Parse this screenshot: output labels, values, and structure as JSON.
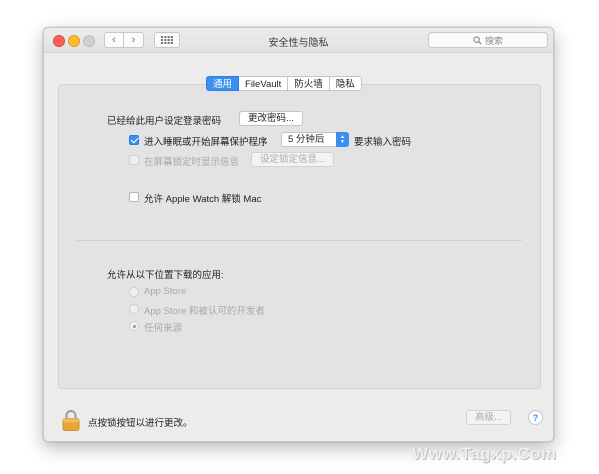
{
  "window": {
    "title": "安全性与隐私",
    "search_placeholder": "搜索",
    "nav_back": "‹",
    "nav_forward": "›"
  },
  "tabs": [
    {
      "label": "通用",
      "active": true
    },
    {
      "label": "FileVault",
      "active": false
    },
    {
      "label": "防火墙",
      "active": false
    },
    {
      "label": "隐私",
      "active": false
    }
  ],
  "general": {
    "password_set_label": "已经给此用户设定登录密码",
    "change_password_button": "更改密码...",
    "require_password": {
      "checked": true,
      "label": "进入睡眠或开始屏幕保护程序",
      "delay_value": "5 分钟后",
      "suffix": "要求输入密码"
    },
    "lock_message": {
      "checked": false,
      "enabled": false,
      "label": "在屏幕锁定时显示信息",
      "button": "设定锁定信息..."
    },
    "apple_watch": {
      "checked": false,
      "label": "允许 Apple Watch 解锁 Mac"
    },
    "downloads": {
      "heading": "允许从以下位置下载的应用:",
      "options": [
        {
          "label": "App Store",
          "selected": false
        },
        {
          "label": "App Store 和被认可的开发者",
          "selected": false
        },
        {
          "label": "任何来源",
          "selected": true
        }
      ]
    }
  },
  "footer": {
    "lock_text": "点按锁按钮以进行更改。",
    "advanced_button": "高级...",
    "help_symbol": "?"
  },
  "watermark": "Www.Tagxp.Com",
  "colors": {
    "accent": "#3b8ff0",
    "window_bg": "#ececec",
    "panel_bg": "#e3e3e3",
    "close": "#fc5f57",
    "minimize": "#fdbc2e",
    "lock_body": "#e8a33a"
  }
}
